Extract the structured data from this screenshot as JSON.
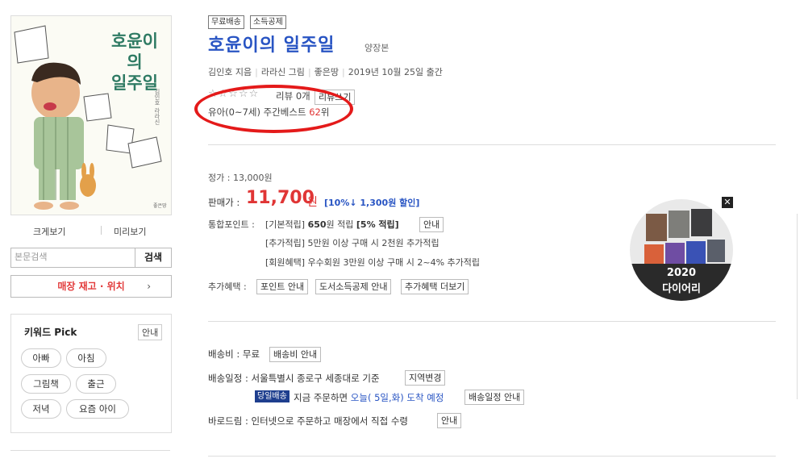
{
  "book": {
    "cover_title_line1": "호윤이의",
    "cover_title_line2": "일주일",
    "cover_credit": "김인호 라라신",
    "cover_publisher": "좋은땅",
    "badges": [
      "무료배송",
      "소득공제"
    ],
    "title": "호윤이의 일주일",
    "binding": "양장본",
    "author": "김인호 지음",
    "illustrator": "라라신 그림",
    "publisher": "좋은땅",
    "pub_date": "2019년 10월 25일 출간",
    "stars": "☆☆☆☆☆",
    "review_text": "리뷰 0개",
    "review_write_btn": "리뷰쓰기",
    "rank_prefix": "유아(0~7세) 주간베스트 ",
    "rank_value": "62",
    "rank_suffix": "위"
  },
  "left": {
    "zoom_view": "크게보기",
    "preview": "미리보기",
    "search_placeholder": "본문검색",
    "search_btn": "검색",
    "store_btn": "매장 재고 · 위치",
    "store_chev": "›",
    "keyword_title": "키워드 Pick",
    "keyword_more": "안내",
    "keywords": [
      "아빠",
      "아침",
      "그림책",
      "출근",
      "저녁",
      "요즘 아이"
    ]
  },
  "price": {
    "list_label": "정가 : ",
    "list_value": "13,000원",
    "sale_label": "판매가 : ",
    "sale_value": "11,700",
    "sale_unit": "원",
    "discount": "[10%↓ 1,300원 할인]",
    "points_label": "통합포인트 : ",
    "point_line1_a": "[기본적립] ",
    "point_line1_b": "650",
    "point_line1_c": "원 적립 ",
    "point_line1_d": "[5% 적립]",
    "point_btn": "안내",
    "point_line2": "[추가적립] 5만원 이상 구매 시 2천원 추가적립",
    "point_line3": "[회원혜택] 우수회원 3만원 이상 구매 시 2~4% 추가적립",
    "extra_label": "추가혜택 : ",
    "extra_btns": [
      "포인트 안내",
      "도서소득공제 안내",
      "추가혜택 더보기"
    ]
  },
  "promo": {
    "year": "2020",
    "name": "다이어리",
    "close": "✕"
  },
  "shipping": {
    "fee_label": "배송비 : 무료",
    "fee_btn": "배송비 안내",
    "schedule_label": "배송일정 : 서울특별시 종로구 세종대로 기준",
    "region_btn": "지역변경",
    "sameday_badge": "당일배송",
    "order_now": "지금 주문하면 ",
    "arrival": "오늘( 5일,화) 도착 예정",
    "schedule_btn": "배송일정 안내",
    "barodrim": "바로드림 : 인터넷으로 주문하고 매장에서 직접 수령",
    "barodrim_btn": "안내"
  }
}
